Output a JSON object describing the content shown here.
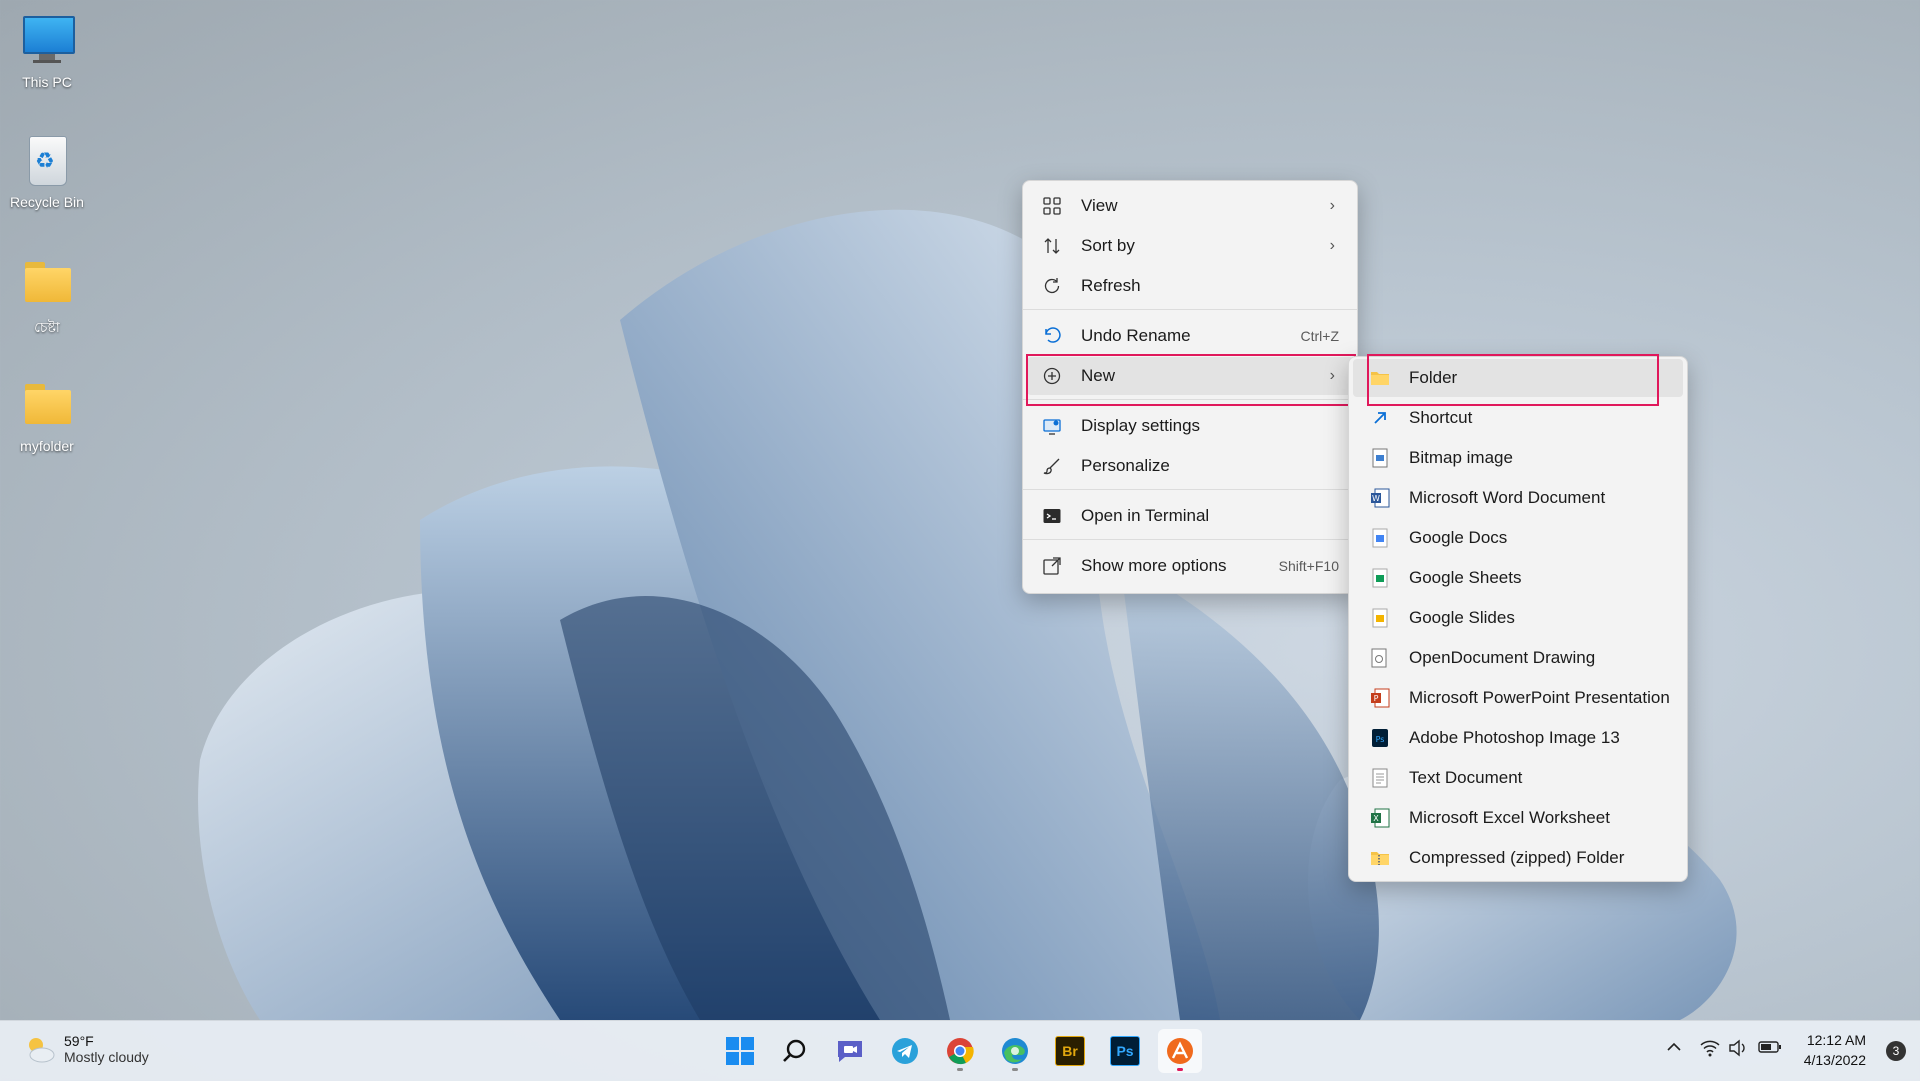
{
  "desktop": {
    "icons": [
      {
        "label": "This PC",
        "icon": "monitor-icon"
      },
      {
        "label": "Recycle Bin",
        "icon": "recycle-bin-icon"
      },
      {
        "label": "চেষ্টা",
        "icon": "folder-icon"
      },
      {
        "label": "myfolder",
        "icon": "folder-icon"
      }
    ]
  },
  "context_menu": {
    "items": [
      {
        "label": "View",
        "icon": "grid-view-icon",
        "submenu": true
      },
      {
        "label": "Sort by",
        "icon": "sort-icon",
        "submenu": true
      },
      {
        "label": "Refresh",
        "icon": "refresh-icon"
      },
      {
        "label": "Undo Rename",
        "icon": "undo-icon",
        "shortcut": "Ctrl+Z"
      },
      {
        "label": "New",
        "icon": "plus-circle-icon",
        "submenu": true,
        "highlighted": true
      },
      {
        "label": "Display settings",
        "icon": "display-icon"
      },
      {
        "label": "Personalize",
        "icon": "brush-icon"
      },
      {
        "label": "Open in Terminal",
        "icon": "terminal-icon"
      },
      {
        "label": "Show more options",
        "icon": "more-options-icon",
        "shortcut": "Shift+F10"
      }
    ]
  },
  "new_submenu": {
    "items": [
      {
        "label": "Folder",
        "icon": "folder-icon",
        "highlighted": true
      },
      {
        "label": "Shortcut",
        "icon": "shortcut-icon"
      },
      {
        "label": "Bitmap image",
        "icon": "bitmap-icon"
      },
      {
        "label": "Microsoft Word Document",
        "icon": "word-icon"
      },
      {
        "label": "Google Docs",
        "icon": "google-docs-icon"
      },
      {
        "label": "Google Sheets",
        "icon": "google-sheets-icon"
      },
      {
        "label": "Google Slides",
        "icon": "google-slides-icon"
      },
      {
        "label": "OpenDocument Drawing",
        "icon": "odg-icon"
      },
      {
        "label": "Microsoft PowerPoint Presentation",
        "icon": "powerpoint-icon"
      },
      {
        "label": "Adobe Photoshop Image 13",
        "icon": "photoshop-file-icon"
      },
      {
        "label": "Text Document",
        "icon": "text-document-icon"
      },
      {
        "label": "Microsoft Excel Worksheet",
        "icon": "excel-icon"
      },
      {
        "label": "Compressed (zipped) Folder",
        "icon": "zip-folder-icon"
      }
    ]
  },
  "taskbar": {
    "weather": {
      "temp": "59°F",
      "condition": "Mostly cloudy"
    },
    "apps": [
      "start-icon",
      "search-icon",
      "teams-chat-icon",
      "telegram-icon",
      "chrome-icon",
      "edge-icon",
      "bridge-icon",
      "photoshop-icon",
      "app-icon"
    ],
    "bridge_label": "Br",
    "photoshop_label": "Ps",
    "clock": {
      "time": "12:12 AM",
      "date": "4/13/2022"
    },
    "notification_count": "3"
  },
  "colors": {
    "highlight_box": "#e0185b",
    "menu_bg": "#f3f3f3",
    "accent_blue": "#0a6fd6"
  }
}
